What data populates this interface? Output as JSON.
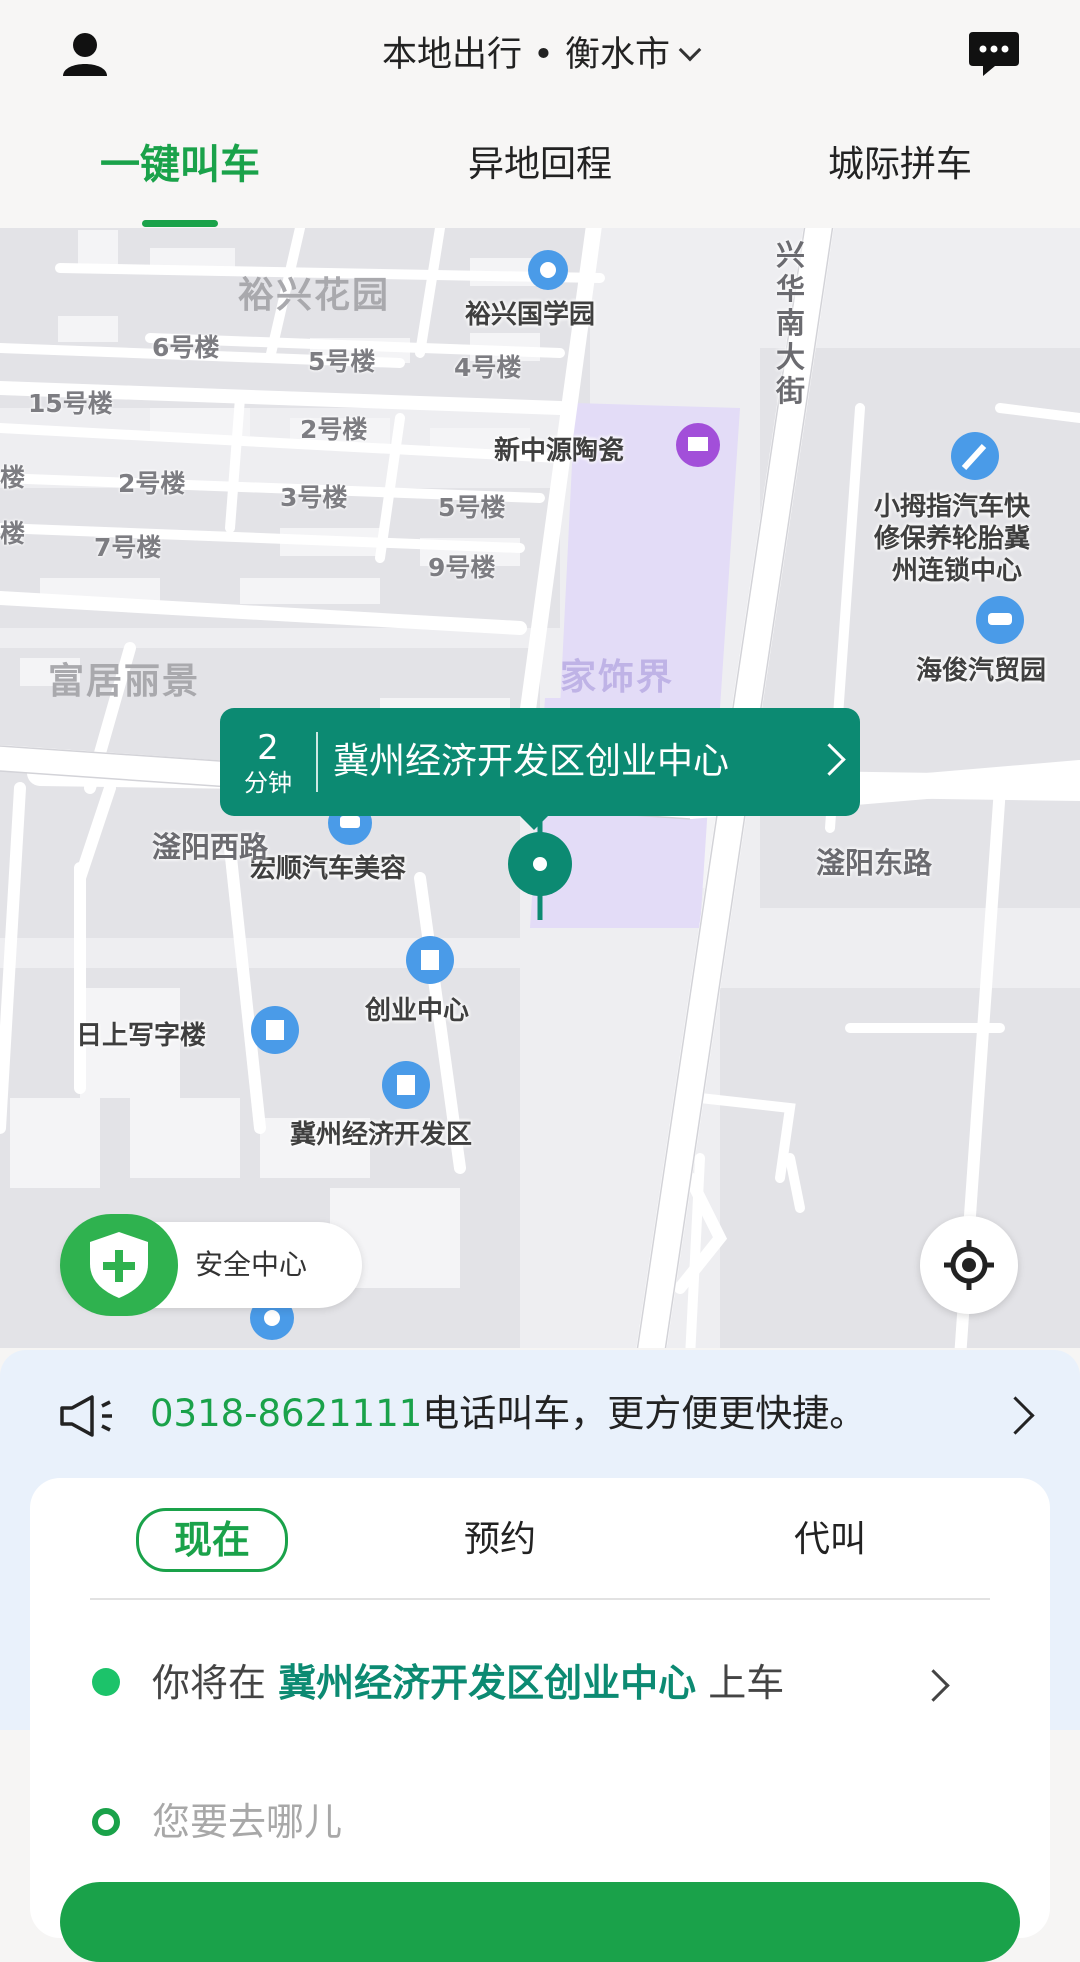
{
  "header": {
    "city_title": "本地出行 • 衡水市",
    "icons": {
      "user": "user-icon",
      "message": "message-icon",
      "city_dropdown": "chevron-down-icon"
    }
  },
  "tabs": [
    {
      "label": "一键叫车",
      "active": true
    },
    {
      "label": "异地回程",
      "active": false
    },
    {
      "label": "城际拼车",
      "active": false
    }
  ],
  "map": {
    "area_labels": [
      "裕兴花园",
      "富居丽景",
      "家饰界"
    ],
    "poi_labels": [
      "裕兴国学园",
      "新中源陶瓷",
      "小拇指汽车快",
      "修保养轮胎冀",
      "州连锁中心",
      "海俊汽贸园",
      "宏顺汽车美容",
      "创业中心",
      "日上写字楼",
      "冀州经济开发区"
    ],
    "building_labels": [
      "6号楼",
      "5号楼",
      "4号楼",
      "15号楼",
      "2号楼",
      "楼",
      "2号楼",
      "3号楼",
      "5号楼",
      "楼",
      "7号楼",
      "9号楼"
    ],
    "road_labels": [
      "兴华南大街",
      "滏阳西路",
      "滏阳东路"
    ],
    "callout": {
      "minutes": "2",
      "unit": "分钟",
      "place": "冀州经济开发区创业中心"
    },
    "safety_center_label": "安全中心",
    "locate_icon": "locate-icon"
  },
  "phone_banner": {
    "number": "0318-8621111",
    "text": "电话叫车，更方便更快捷。"
  },
  "ride_card": {
    "modes": [
      "现在",
      "预约",
      "代叫"
    ],
    "active_mode": "现在",
    "pickup_prefix": "你将在",
    "pickup_place": "冀州经济开发区创业中心",
    "pickup_suffix": "上车",
    "destination_placeholder": "您要去哪儿"
  },
  "colors": {
    "accent": "#1aa24a",
    "callout": "#0c8a72",
    "pickup_dot": "#1cc36a"
  }
}
